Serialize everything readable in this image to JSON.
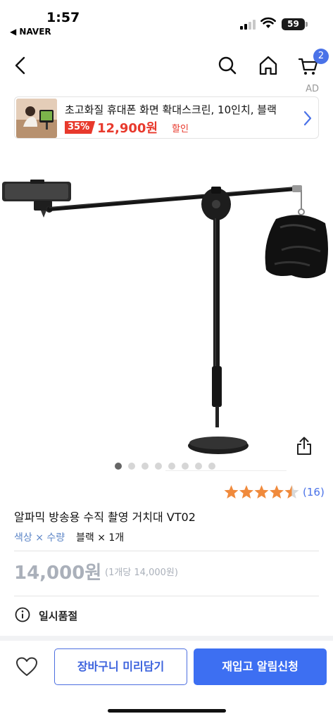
{
  "status_bar": {
    "time": "1:57",
    "back_app": "◀ NAVER",
    "battery": "59"
  },
  "nav": {
    "cart_count": "2",
    "icons": [
      "back-arrow-icon",
      "search-icon",
      "home-icon",
      "cart-icon"
    ]
  },
  "ad": {
    "label": "AD",
    "title": "초고화질 휴대폰 화면 확대스크린, 10인치, 블랙",
    "discount": "35%",
    "price": "12,900원",
    "sale_tag": "할인"
  },
  "gallery": {
    "image_count": 8,
    "active_index": 0
  },
  "rating": {
    "score": 4.5,
    "max": 5,
    "review_count": "(16)",
    "star_color": "#f08a3c"
  },
  "product": {
    "title": "알파믹 방송용 수직 촬영 거치대 VT02",
    "option_label": "색상 × 수량",
    "option_value": "블랙 × 1개",
    "price": "14,000원",
    "unit_price": "(1개당 14,000원)",
    "status": "일시품절"
  },
  "actions": {
    "cart_button": "장바구니 미리담기",
    "restock_button": "재입고 알림신청"
  },
  "colors": {
    "accent": "#3d6ff2",
    "sale_red": "#e8392c",
    "muted_price": "#aab0ba"
  }
}
